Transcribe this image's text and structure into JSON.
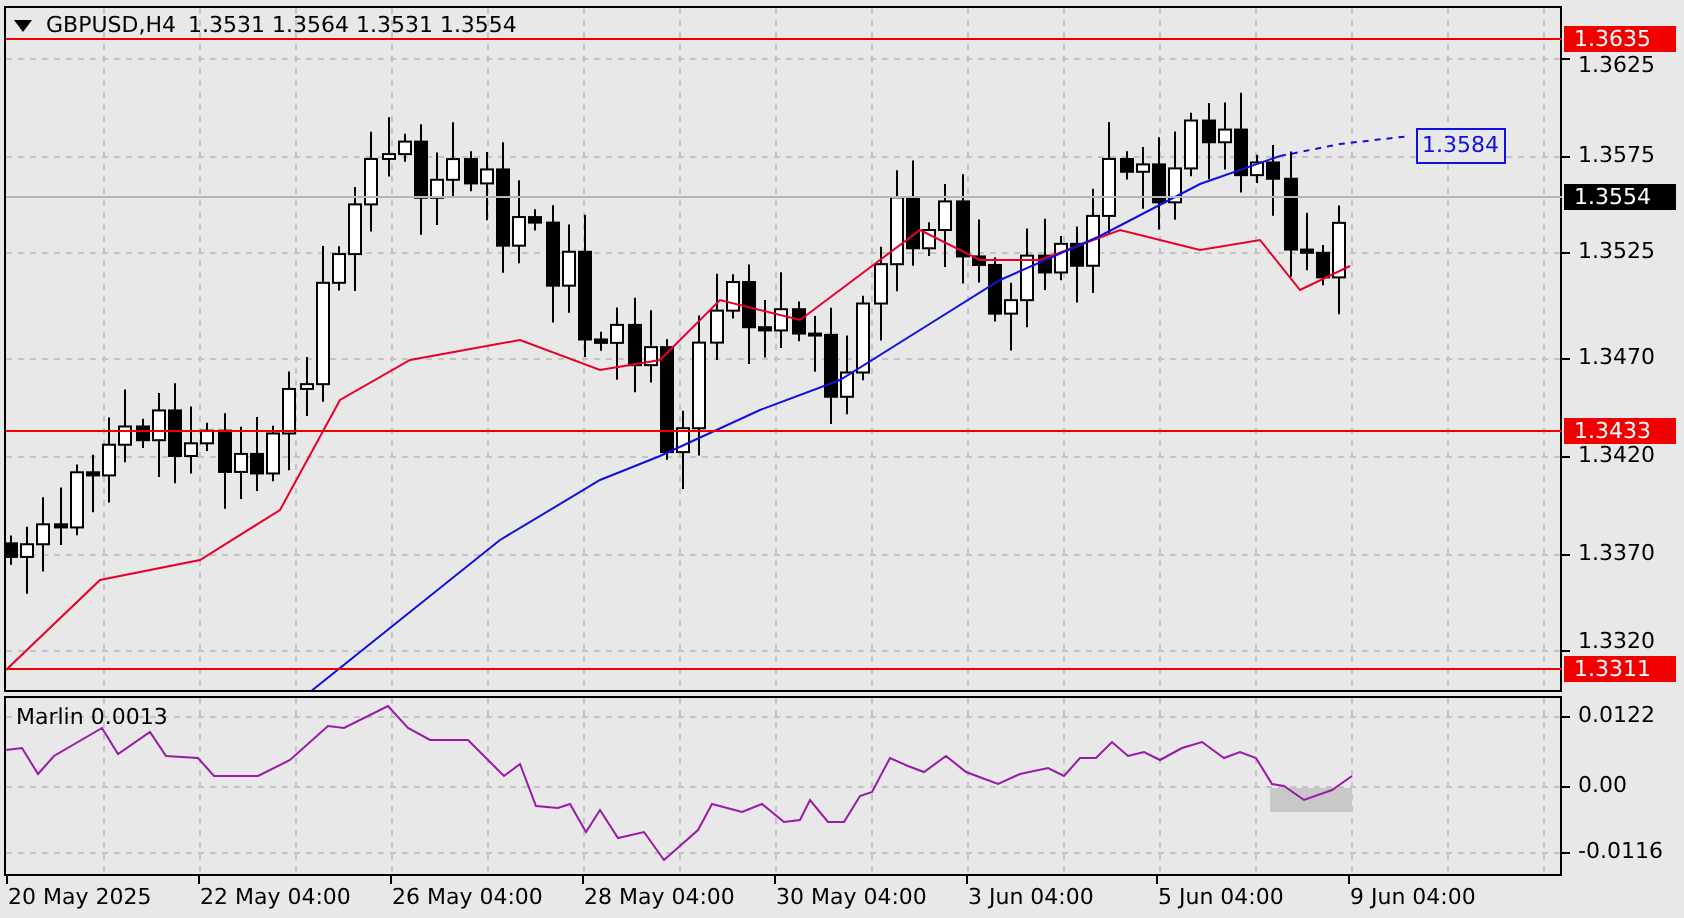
{
  "header": {
    "symbol": "GBPUSD,H4",
    "ohlc": "1.3531 1.3564 1.3531 1.3554"
  },
  "price_axis": {
    "ticks": [
      "1.3625",
      "1.3575",
      "1.3525",
      "1.3470",
      "1.3420",
      "1.3370",
      "1.3320"
    ]
  },
  "price_tags": [
    {
      "kind": "level",
      "label": "1.3635"
    },
    {
      "kind": "average",
      "label": "1.3584"
    },
    {
      "kind": "current",
      "label": "1.3554"
    },
    {
      "kind": "level",
      "label": "1.3433"
    },
    {
      "kind": "level",
      "label": "1.3311"
    }
  ],
  "indicator": {
    "label": "Marlin 0.0013",
    "ticks": [
      "0.0122",
      "0.00",
      "-0.0116"
    ]
  },
  "time_axis": {
    "labels": [
      "20 May 2025",
      "22 May 04:00",
      "26 May 04:00",
      "28 May 04:00",
      "30 May 04:00",
      "3 Jun 04:00",
      "5 Jun 04:00",
      "9 Jun 04:00"
    ]
  }
}
